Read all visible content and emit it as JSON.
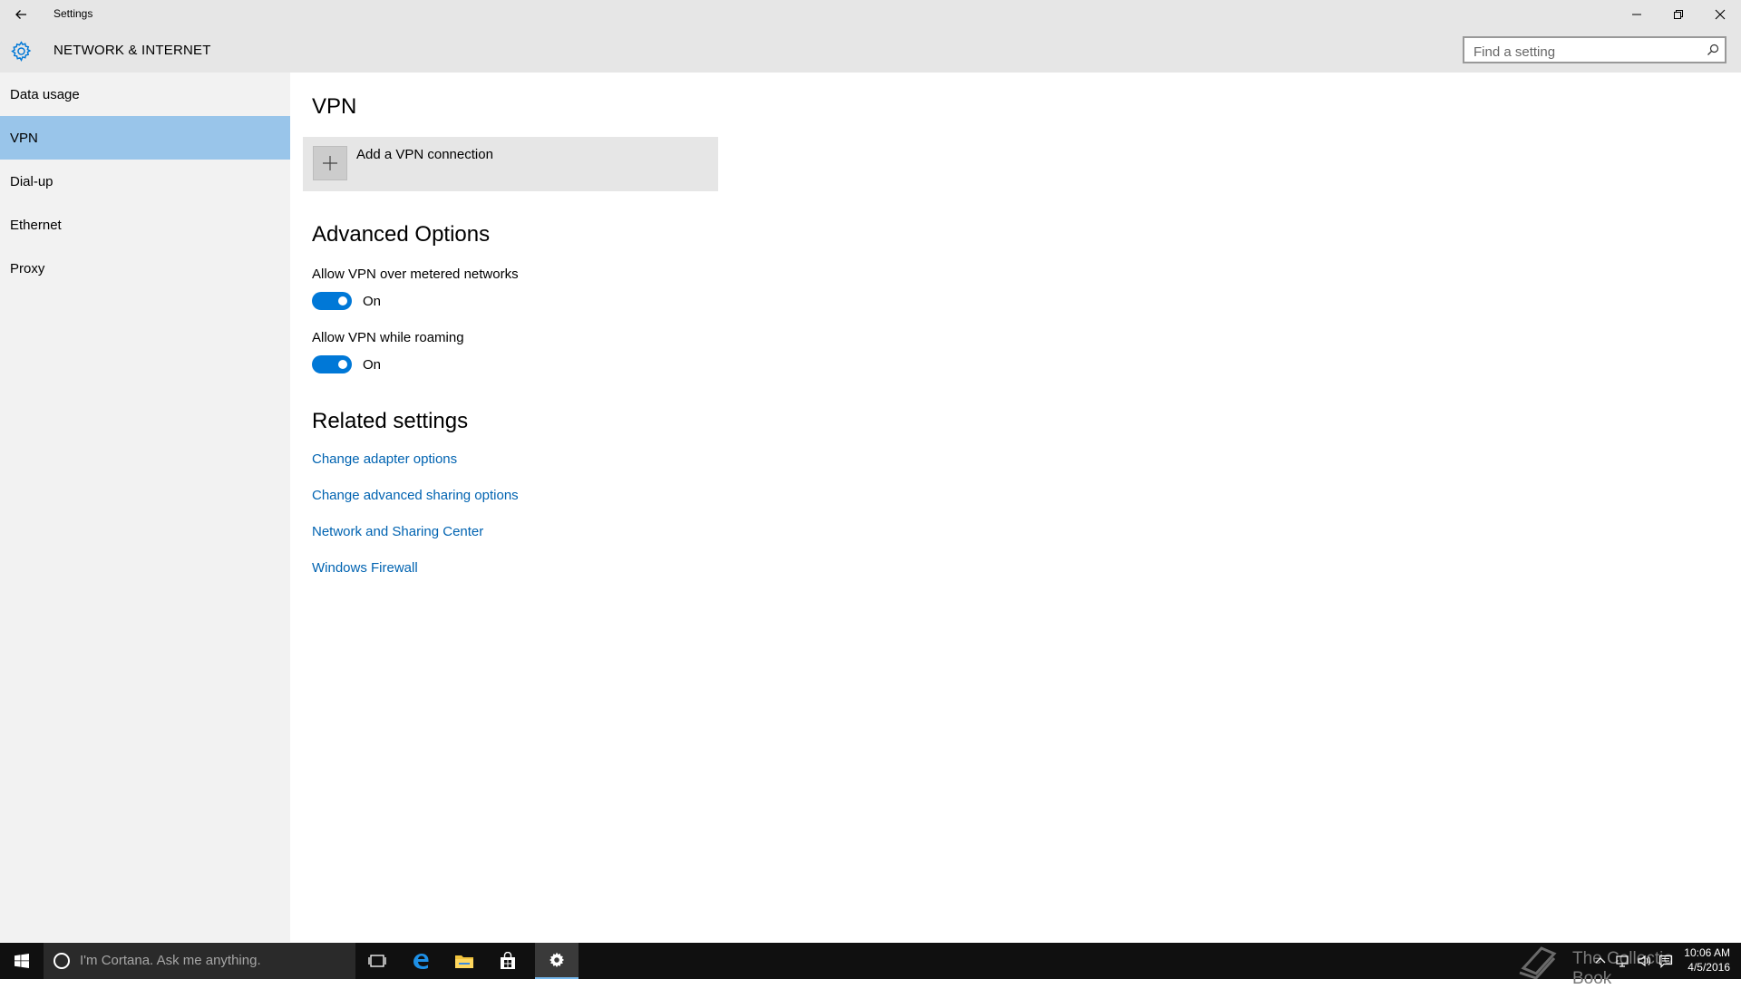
{
  "window": {
    "title": "Settings",
    "controls": [
      "minimize",
      "restore",
      "close"
    ]
  },
  "header": {
    "title": "NETWORK & INTERNET",
    "search": {
      "placeholder": "Find a setting",
      "value": ""
    }
  },
  "sidebar": {
    "items": [
      {
        "label": "Data usage",
        "active": false
      },
      {
        "label": "VPN",
        "active": true
      },
      {
        "label": "Dial-up",
        "active": false
      },
      {
        "label": "Ethernet",
        "active": false
      },
      {
        "label": "Proxy",
        "active": false
      }
    ]
  },
  "main": {
    "vpn_heading": "VPN",
    "add_vpn_label": "Add a VPN connection",
    "advanced": {
      "heading": "Advanced Options",
      "options": [
        {
          "label": "Allow VPN over metered networks",
          "state": "On",
          "on": true
        },
        {
          "label": "Allow VPN while roaming",
          "state": "On",
          "on": true
        }
      ]
    },
    "related": {
      "heading": "Related settings",
      "links": [
        "Change adapter options",
        "Change advanced sharing options",
        "Network and Sharing Center",
        "Windows Firewall"
      ]
    }
  },
  "taskbar": {
    "search_placeholder": "I'm Cortana. Ask me anything.",
    "apps": [
      "task-view-icon",
      "edge-icon",
      "file-explorer-icon",
      "store-icon",
      "settings-icon"
    ],
    "active_app": "settings-icon",
    "watermark": "The Collectio  Book",
    "clock": {
      "time": "10:06 AM",
      "date": "4/5/2016"
    }
  },
  "colors": {
    "accent": "#0078d7",
    "nav_selected": "#99c5ea",
    "link": "#0063b1",
    "chrome": "#e6e6e6",
    "sidebar": "#f2f2f2",
    "taskbar": "#101010"
  }
}
